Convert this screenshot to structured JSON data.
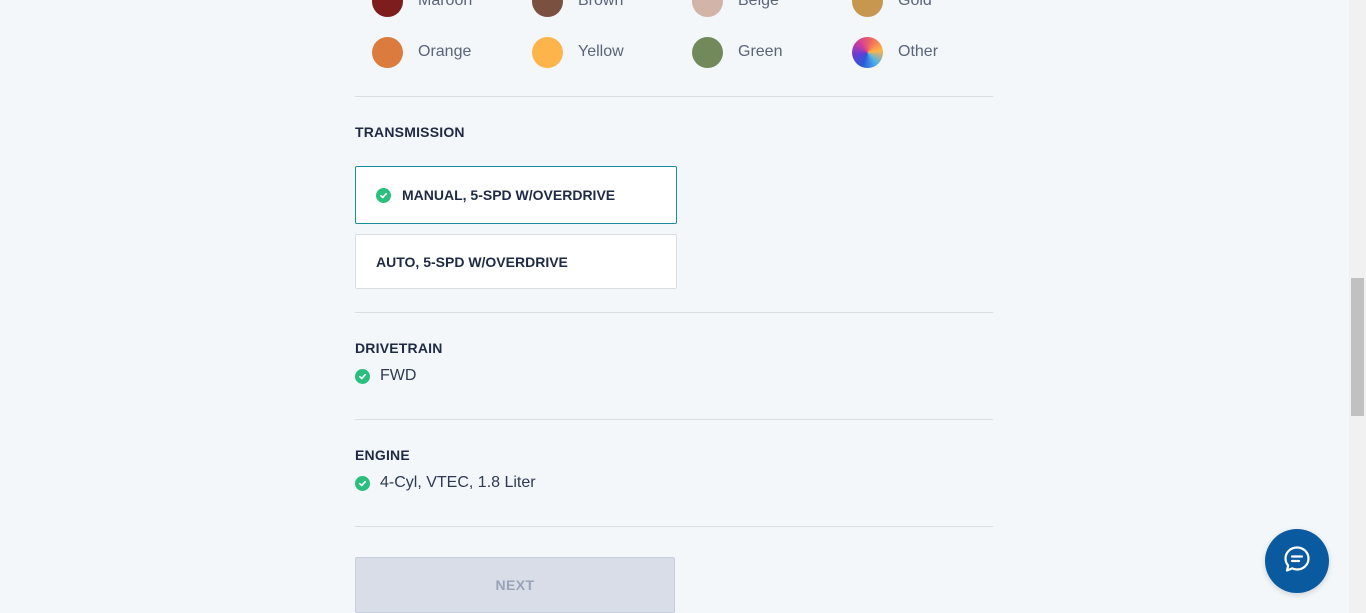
{
  "colors": {
    "row1": [
      {
        "label": "Maroon",
        "hex": "#7d1d1d"
      },
      {
        "label": "Brown",
        "hex": "#7a5040"
      },
      {
        "label": "Beige",
        "hex": "#d3b4a8"
      },
      {
        "label": "Gold",
        "hex": "#c8974f"
      }
    ],
    "row2": [
      {
        "label": "Orange",
        "hex": "#db7b3e"
      },
      {
        "label": "Yellow",
        "hex": "#fdb44b"
      },
      {
        "label": "Green",
        "hex": "#728a5b"
      },
      {
        "label": "Other",
        "hex": "gradient"
      }
    ]
  },
  "transmission": {
    "title": "TRANSMISSION",
    "options": [
      {
        "label": "MANUAL, 5-SPD W/OVERDRIVE",
        "selected": true
      },
      {
        "label": "AUTO, 5-SPD W/OVERDRIVE",
        "selected": false
      }
    ]
  },
  "drivetrain": {
    "title": "DRIVETRAIN",
    "value": "FWD"
  },
  "engine": {
    "title": "ENGINE",
    "value": "4-Cyl, VTEC, 1.8 Liter"
  },
  "next_button": {
    "label": "NEXT"
  },
  "theme": {
    "accent": "#1a8c9a",
    "check_green": "#2bbf7e",
    "chat_blue": "#0a5aa0"
  },
  "icons": {
    "check": "check-circle-icon",
    "chat": "chat-bubble-icon"
  }
}
